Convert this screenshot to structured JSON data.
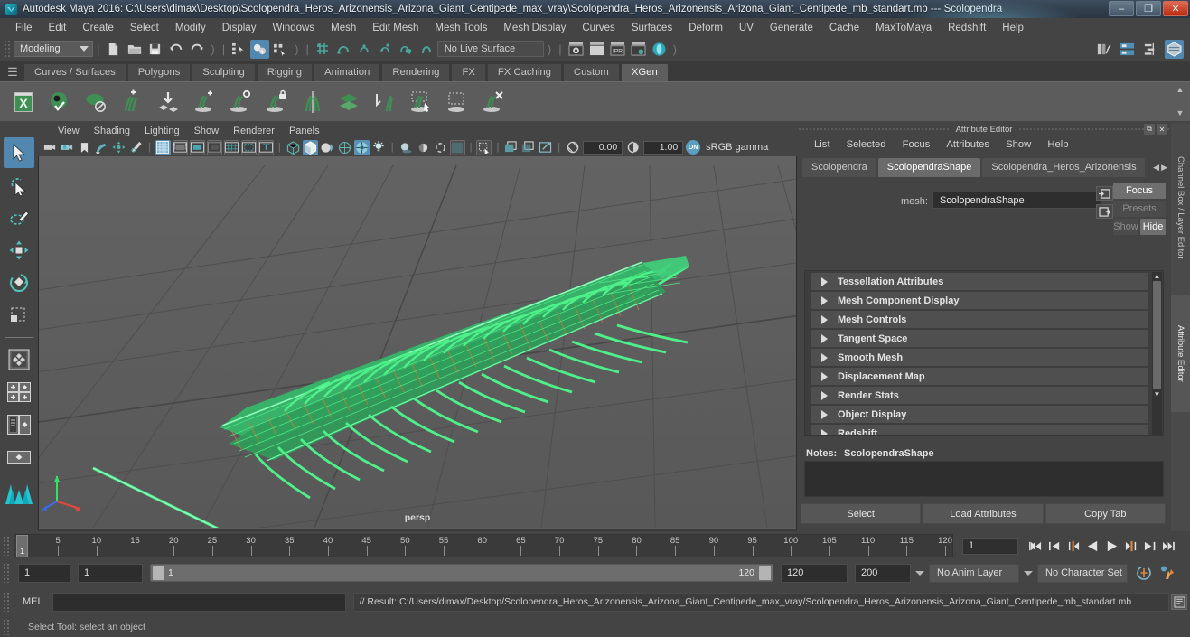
{
  "titlebar": {
    "title": "Autodesk Maya 2016: C:\\Users\\dimax\\Desktop\\Scolopendra_Heros_Arizonensis_Arizona_Giant_Centipede_max_vray\\Scolopendra_Heros_Arizonensis_Arizona_Giant_Centipede_mb_standart.mb  ---  Scolopendra",
    "minimize": "–",
    "maximize": "❐",
    "close": "✕",
    "app_icon": "maya-logo-icon"
  },
  "menubar": {
    "items": [
      "File",
      "Edit",
      "Create",
      "Select",
      "Modify",
      "Display",
      "Windows",
      "Mesh",
      "Edit Mesh",
      "Mesh Tools",
      "Mesh Display",
      "Curves",
      "Surfaces",
      "Deform",
      "UV",
      "Generate",
      "Cache",
      "MaxToMaya",
      "Redshift",
      "Help"
    ]
  },
  "statusline": {
    "mode": "Modeling",
    "live_surface": "No Live Surface",
    "file_icons": [
      "new-scene-icon",
      "open-scene-icon",
      "save-scene-icon",
      "undo-icon",
      "redo-icon"
    ],
    "select_mask_icons": [
      "select-by-hierarchy-icon",
      "select-by-object-type-icon",
      "select-by-component-type-icon"
    ],
    "snap_icons": [
      "snap-to-grid-icon",
      "snap-to-curve-icon",
      "snap-to-point-icon",
      "snap-to-projected-center-icon",
      "snap-to-view-plane-icon",
      "make-live-icon"
    ],
    "render_icons": [
      "render-current-frame-icon",
      "render-sequence-icon",
      "ipr-render-icon",
      "render-settings-icon",
      "hypershade-icon"
    ],
    "right_icons": [
      "animation-editors-icon",
      "rendering-editors-icon",
      "relationship-editors-icon",
      "attribute-editor-toggle-icon"
    ]
  },
  "shelf": {
    "hamburger": "☰",
    "tabs": [
      "Curves / Surfaces",
      "Polygons",
      "Sculpting",
      "Rigging",
      "Animation",
      "Rendering",
      "FX",
      "FX Caching",
      "Custom",
      "XGen"
    ],
    "active_tab": "XGen",
    "icons": [
      "xgen-editor-icon",
      "xgen-preview-icon",
      "xgen-geometry-icon",
      "xgen-add-description-icon",
      "xgen-import-collection-icon",
      "xgen-add-grooming-icon",
      "xgen-guide-visibility-icon",
      "xgen-lock-guide-icon",
      "xgen-mirror-guides-icon",
      "xgen-layers-icon",
      "xgen-convert-to-interactive-icon",
      "xgen-select-guides-icon",
      "xgen-bake-icon",
      "xgen-delete-guides-icon"
    ],
    "scroll_up": "▲",
    "scroll_down": "▼"
  },
  "viewport": {
    "menus": [
      "View",
      "Shading",
      "Lighting",
      "Show",
      "Renderer",
      "Panels"
    ],
    "toolbar_icons": [
      "select-camera-icon",
      "camera-attributes-icon",
      "bookmark-icon",
      "image-plane-icon",
      "two-d-pan-zoom-icon",
      "grease-pencil-icon",
      "grid-icon",
      "film-gate-icon",
      "resolution-gate-icon",
      "gate-mask-icon",
      "field-chart-icon",
      "safe-action-icon",
      "safe-title-icon",
      "wireframe-icon",
      "smooth-shade-all-icon",
      "shade-selected-icon",
      "wireframe-on-shaded-icon",
      "texture-icon",
      "use-all-lights-icon",
      "shadows-icon",
      "screen-space-ao-icon",
      "motion-blur-icon",
      "multisample-aa-icon",
      "depth-of-field-icon",
      "isolate-select-icon",
      "xray-icon",
      "xray-joints-icon",
      "xray-active-components-icon",
      "exposure-icon",
      "gamma-icon"
    ],
    "exposure_value": "0.00",
    "gamma_value": "1.00",
    "color_toggle": "ON",
    "color_space": "sRGB gamma",
    "camera_label": "persp"
  },
  "attribute_editor": {
    "panel_title": "Attribute Editor",
    "undock_icon": "undock-icon",
    "close_icon": "close-icon",
    "menus": [
      "List",
      "Selected",
      "Focus",
      "Attributes",
      "Show",
      "Help"
    ],
    "tabs": [
      "Scolopendra",
      "ScolopendraShape",
      "Scolopendra_Heros_Arizonensis"
    ],
    "active_tab": "ScolopendraShape",
    "tab_prev": "◀",
    "tab_next": "▶",
    "mesh_label": "mesh:",
    "mesh_value": "ScolopendraShape",
    "nav_left_icon": "input-connection-icon",
    "nav_right_icon": "output-connection-icon",
    "focus_button": "Focus",
    "presets_button": "Presets",
    "show_button": "Show",
    "hide_button": "Hide",
    "sections": [
      "Tessellation Attributes",
      "Mesh Component Display",
      "Mesh Controls",
      "Tangent Space",
      "Smooth Mesh",
      "Displacement Map",
      "Render Stats",
      "Object Display",
      "Redshift"
    ],
    "scroll_up": "▲",
    "scroll_down": "▼",
    "notes_label": "Notes:",
    "notes_value": "ScolopendraShape",
    "notes_text": "",
    "footer_buttons": [
      "Select",
      "Load Attributes",
      "Copy Tab"
    ]
  },
  "vertical_tabs": {
    "channel_box": "Channel Box / Layer Editor",
    "attribute_editor": "Attribute Editor"
  },
  "toolbox": {
    "items": [
      "select-tool-icon",
      "lasso-select-tool-icon",
      "paint-select-tool-icon",
      "move-tool-icon",
      "rotate-tool-icon",
      "scale-tool-icon",
      "last-tool-used-icon",
      "four-view-layout-icon",
      "persp-outliner-layout-icon",
      "persp-graph-layout-icon",
      "single-persp-layout-icon",
      "maya-logo-icon"
    ],
    "selected": "select-tool-icon"
  },
  "time_slider": {
    "current_frame": "1",
    "ticks": [
      5,
      10,
      15,
      20,
      25,
      30,
      35,
      40,
      45,
      50,
      55,
      60,
      65,
      70,
      75,
      80,
      85,
      90,
      95,
      100,
      105,
      110,
      115,
      120
    ],
    "start": 1,
    "end": 120,
    "frame_field": "1",
    "playback_buttons": [
      "go-to-start-icon",
      "step-back-keyframe-icon",
      "step-back-frame-icon",
      "play-backwards-icon",
      "play-forwards-icon",
      "step-forward-frame-icon",
      "step-forward-keyframe-icon",
      "go-to-end-icon"
    ]
  },
  "range_slider": {
    "anim_start": "1",
    "range_start": "1",
    "bar_min": "1",
    "bar_max": "120",
    "range_end": "120",
    "anim_end": "200",
    "anim_layer": "No Anim Layer",
    "character_set": "No Character Set",
    "auto_keyframe_icon": "auto-keyframe-icon",
    "animation_prefs_icon": "animation-preferences-icon"
  },
  "command_line": {
    "label": "MEL",
    "input_value": "",
    "result": "// Result: C:/Users/dimax/Desktop/Scolopendra_Heros_Arizonensis_Arizona_Giant_Centipede_max_vray/Scolopendra_Heros_Arizonensis_Arizona_Giant_Centipede_mb_standart.mb",
    "script_editor_icon": "script-editor-icon"
  },
  "help_line": {
    "text": "Select Tool: select an object"
  },
  "colors": {
    "accent_blue": "#5287b0",
    "mesh_green": "#4ef08a",
    "panel_bg": "#444444",
    "viewport_bg": "#5e5e5e",
    "title_gradient_start": "#3e4e60",
    "close_red": "#bb2a12",
    "orange_marker": "#e08a3c"
  }
}
